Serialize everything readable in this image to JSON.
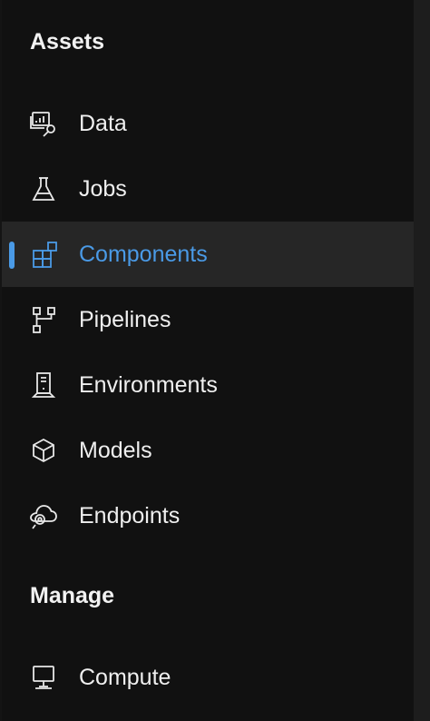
{
  "nav": {
    "assets_header": "Assets",
    "manage_header": "Manage",
    "items": [
      {
        "label": "Data",
        "icon": "data-search-icon"
      },
      {
        "label": "Jobs",
        "icon": "flask-icon"
      },
      {
        "label": "Components",
        "icon": "components-icon",
        "selected": true
      },
      {
        "label": "Pipelines",
        "icon": "pipeline-icon"
      },
      {
        "label": "Environments",
        "icon": "environment-icon"
      },
      {
        "label": "Models",
        "icon": "cube-icon"
      },
      {
        "label": "Endpoints",
        "icon": "cloud-endpoint-icon"
      }
    ],
    "manage_items": [
      {
        "label": "Compute",
        "icon": "monitor-icon"
      }
    ]
  },
  "colors": {
    "background": "#111111",
    "selected_background": "#262626",
    "accent": "#4a9ae6",
    "text": "#efefef"
  }
}
